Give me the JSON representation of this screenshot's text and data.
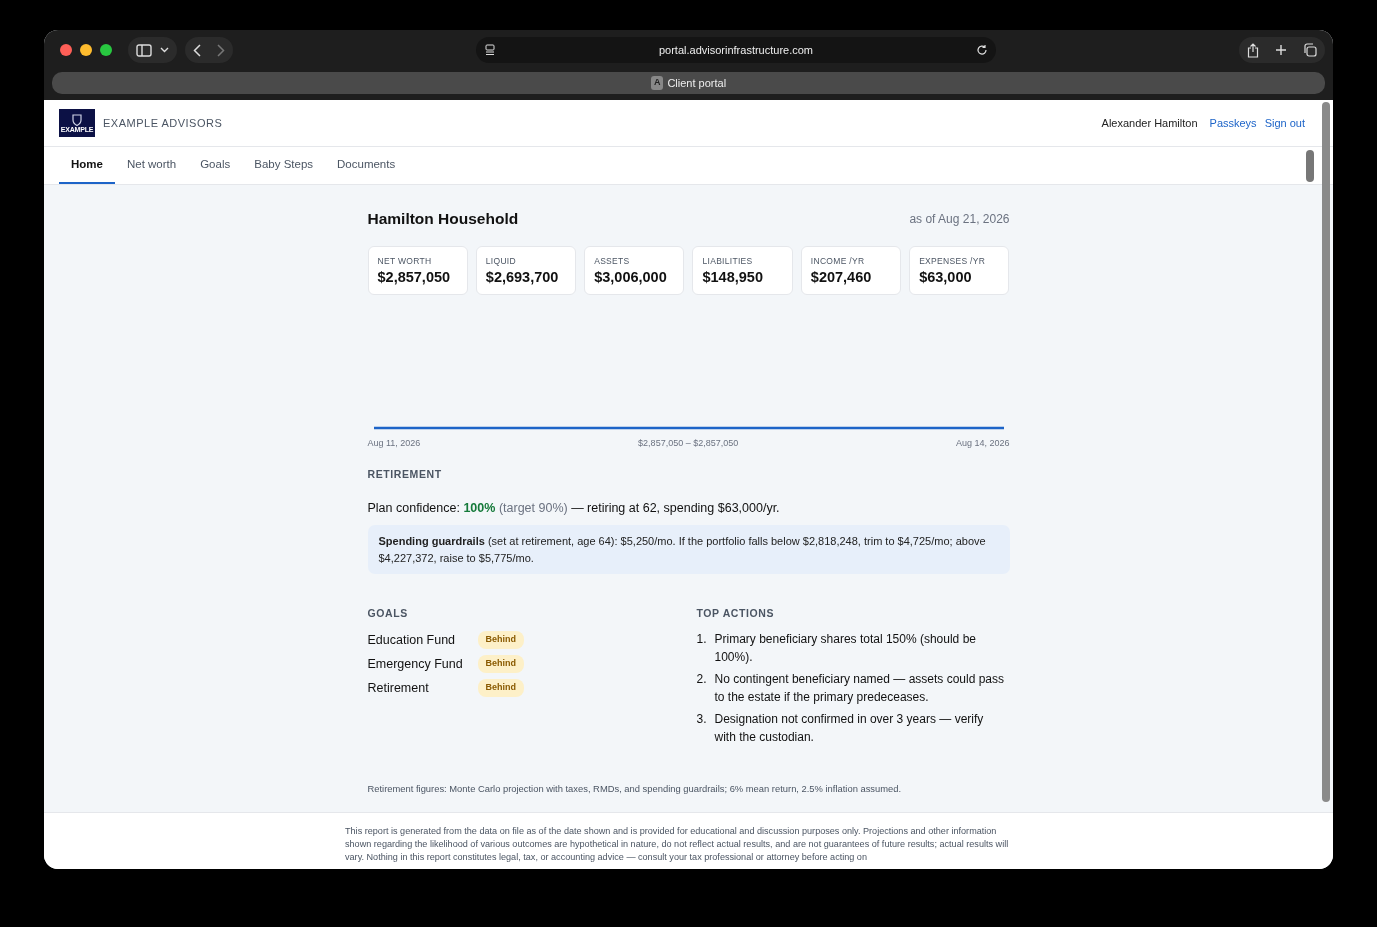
{
  "browser": {
    "url": "portal.advisorinfrastructure.com",
    "tab_badge": "A",
    "tab_title": "Client portal"
  },
  "header": {
    "logo_text": "EXAMPLE",
    "brand": "EXAMPLE ADVISORS",
    "user": "Alexander Hamilton",
    "links": [
      "Passkeys",
      "Sign out"
    ]
  },
  "tabs": [
    {
      "label": "Home",
      "selected": true
    },
    {
      "label": "Net worth",
      "selected": false
    },
    {
      "label": "Goals",
      "selected": false
    },
    {
      "label": "Baby Steps",
      "selected": false
    },
    {
      "label": "Documents",
      "selected": false
    }
  ],
  "household": {
    "title": "Hamilton Household",
    "as_of": "as of Aug 21, 2026"
  },
  "stats": [
    {
      "label": "NET WORTH",
      "value": "$2,857,050"
    },
    {
      "label": "LIQUID",
      "value": "$2,693,700"
    },
    {
      "label": "ASSETS",
      "value": "$3,006,000"
    },
    {
      "label": "LIABILITIES",
      "value": "$148,950"
    },
    {
      "label": "INCOME /YR",
      "value": "$207,460"
    },
    {
      "label": "EXPENSES /YR",
      "value": "$63,000"
    }
  ],
  "chart": {
    "start_label": "Aug 11, 2026",
    "range_label": "$2,857,050 – $2,857,050",
    "end_label": "Aug 14, 2026"
  },
  "retirement": {
    "heading": "RETIREMENT",
    "confidence_prefix": "Plan confidence:",
    "confidence_value": "100%",
    "confidence_target": "(target 90%)",
    "confidence_suffix": "— retiring at 62, spending $63,000/yr.",
    "guardrails": "**Spending guardrails** (set at retirement, age 64): $5,250/mo. If the portfolio falls below $2,818,248, trim to $4,725/mo; above $4,227,372, raise to $5,775/mo."
  },
  "goals": {
    "heading": "GOALS",
    "items": [
      {
        "name": "Education Fund",
        "status": "Behind"
      },
      {
        "name": "Emergency Fund",
        "status": "Behind"
      },
      {
        "name": "Retirement",
        "status": "Behind"
      }
    ]
  },
  "actions": {
    "heading": "TOP ACTIONS",
    "items": [
      {
        "number": "1.",
        "text": "Primary beneficiary shares total 150% (should be 100%)."
      },
      {
        "number": "2.",
        "text": "No contingent beneficiary named — assets could pass to the estate if the primary predeceases."
      },
      {
        "number": "3.",
        "text": "Designation not confirmed in over 3 years — verify with the custodian."
      }
    ]
  },
  "footnote": "Retirement figures: Monte Carlo projection with taxes, RMDs, and spending guardrails; 6% mean return, 2.5% inflation assumed.",
  "disclaimer": "This report is generated from the data on file as of the date shown and is provided for educational and discussion purposes only. Projections and other information shown regarding the likelihood of various outcomes are hypothetical in nature, do not reflect actual results, and are not guarantees of future results; actual results will vary. Nothing in this report constitutes legal, tax, or accounting advice — consult your tax professional or attorney before acting on"
}
